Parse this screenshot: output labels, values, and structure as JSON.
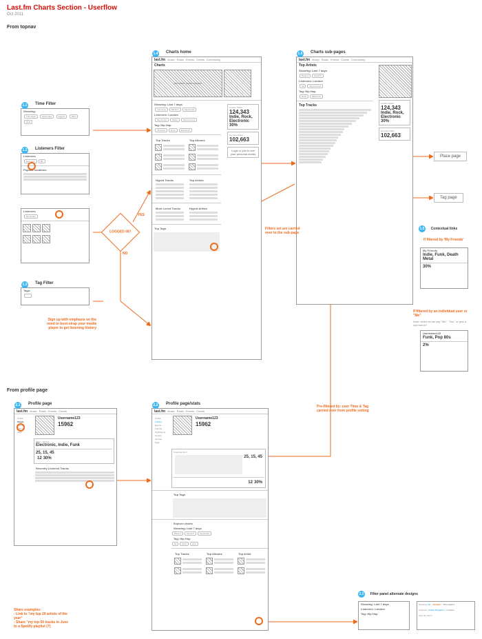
{
  "page": {
    "title": "Last.fm Charts Section - Userflow",
    "date": "Oct 2011"
  },
  "sections": {
    "top": "From topnav",
    "profile": "From profile page"
  },
  "panels": {
    "time": {
      "num": "1.1",
      "title": "Time Filter",
      "label": "Showing:"
    },
    "listeners": {
      "num": "1.2",
      "title": "Listeners Filter",
      "popular": "Popular locations",
      "listeners": "Listeners"
    },
    "tag": {
      "num": "1.3",
      "title": "Tag Filter",
      "label": "Tags:"
    },
    "home": {
      "num": "1.4",
      "title": "Charts home",
      "charts": "Charts",
      "teaser": "EDITORIAL CHART TEASER",
      "showing": "Showing: Last 7 days",
      "listeners": "Listeners: London",
      "taghh": "Tag: Hip Hop",
      "toptracks": "Top Tracks",
      "topalbums": "Top Albums",
      "hyped": "Hyped Tracks",
      "topartists": "Top Artists",
      "mostloved": "Most Loved Tracks",
      "hypedartists": "Hyped Artists",
      "toptags": "Top Tags",
      "login": "Login or join to see your personal charts"
    },
    "sub": {
      "num": "1.5",
      "title": "Charts sub-pages",
      "ta": "Top Artists",
      "tt": "Top Tracks"
    },
    "profile": {
      "num": "2.1",
      "title": "Profile page",
      "user": "Username123",
      "plays": "15962",
      "stats": "Stats – All time",
      "genres": "Electronic, Indie, Funk",
      "nums": "25, 15, 45",
      "row2a": "12",
      "row2b": "30%",
      "recent": "Recently Listened Tracks"
    },
    "pstats": {
      "num": "2.2",
      "title": "Profile page/stats",
      "trend": "Listening trend",
      "toptags": "Top Tags",
      "explore": "Explore charts",
      "tt": "Top Tracks",
      "ta": "Top Albums",
      "tar": "Top Artist"
    },
    "alt": {
      "num": "2.3",
      "title": "Filter panel alternate designs"
    }
  },
  "cards": {
    "london": {
      "t": "London charts",
      "n": "124,343",
      "g": "Indie, Rock, Electronic",
      "p": "30%"
    },
    "hiphop": {
      "t": "Hip Hop charts",
      "n": "102,663"
    },
    "friends": {
      "t": "My Friends",
      "g": "Indie, Funk, Death Metal",
      "p": "30%"
    },
    "user": {
      "t": "Username123",
      "g": "Funk, Pop 80s",
      "p": "2%"
    }
  },
  "links": {
    "place": "Place page",
    "tag": "Tag page",
    "ctx": "Contextual links"
  },
  "notes": {
    "signup": "Sign up with emphasis on the need to boot-strap your media player to get listening history",
    "carryover": "Filters set are carried over to the sub-page",
    "prefilter": "Pre-filtered by: user Time & Tag carried over from profile setting",
    "share": "Share examples:\n- Link to \"my top 20 artists of the year\"\n- Share \"my top 50 tracks in June to a Spotify playlist (?)",
    "friends": "If filtered by 'My Friends'",
    "userfilter": "If filtered by an individual user or \"Me\"",
    "usernote": "Note: when do we say \"Me\", \"You\" or give a username?",
    "yes": "YES",
    "no": "NO",
    "logged": "LOGGED IN?"
  },
  "pills": {
    "thisweek": "This week",
    "december": "December",
    "august": "August",
    "y2012": "2012",
    "y2011": "2011",
    "everyone": "Everyone",
    "me": "Me",
    "uk": "United Kingdom",
    "london": "London"
  }
}
